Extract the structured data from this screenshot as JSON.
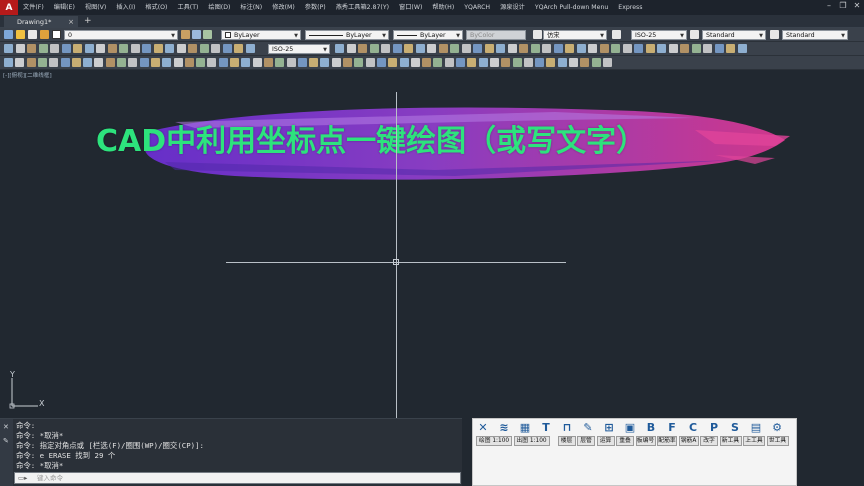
{
  "app": {
    "logo": "A"
  },
  "menu": [
    "文件(F)",
    "编辑(E)",
    "视图(V)",
    "插入(I)",
    "格式(O)",
    "工具(T)",
    "绘图(D)",
    "标注(N)",
    "修改(M)",
    "参数(P)",
    "燕秀工具箱2.87(Y)",
    "窗口(W)",
    "帮助(H)",
    "YQARCH",
    "源泉设计",
    "YQArch Pull-down Menu",
    "Express"
  ],
  "window_controls": {
    "minimize": "–",
    "restore": "❐",
    "close": "✕"
  },
  "tabs": {
    "active": "Drawing1*",
    "close": "×",
    "add": "+"
  },
  "toolbar1": {
    "layer": "0",
    "color": "ByLayer",
    "linetype": "ByLayer",
    "lineweight": "ByLayer",
    "plotstyle": "ByColor",
    "textstyle_font": "仿宋",
    "dimstyle": "ISO-25",
    "tablestyle": "Standard",
    "mleaderstyle": "Standard"
  },
  "toolbar2": {
    "dimstyle": "ISO-25"
  },
  "canvas": {
    "view_label": "[-][俯视][二维线框]",
    "title": "CAD中利用坐标点一键绘图（或写文字）",
    "ucs_x": "X",
    "ucs_y": "Y"
  },
  "command": {
    "lines": [
      "命令:",
      "命令: *取消*",
      "命令: 指定对角点或 [栏选(F)/圈围(WP)/圈交(CP)]:",
      "命令: e ERASE 找到 29 个",
      "命令: *取消*"
    ],
    "placeholder": "键入命令"
  },
  "tool_panel": {
    "icons": [
      "✕",
      "≋",
      "▦",
      "T",
      "⊓",
      "✎",
      "⊞",
      "▣",
      "B",
      "F",
      "C",
      "P",
      "S",
      "▤",
      "⚙"
    ],
    "buttons": [
      "绘图 1:100",
      "出图 1:100",
      "楼层",
      "层管",
      "运算",
      "重叠",
      "板编号",
      "配筋率",
      "钢筋A",
      "改字",
      "新工具",
      "上工具",
      "世工具"
    ]
  },
  "colors": {
    "title_green": "#2de37d",
    "canvas_bg": "#212830",
    "brush_purple": "#8a3fd1",
    "brush_pink": "#d23a9a"
  }
}
